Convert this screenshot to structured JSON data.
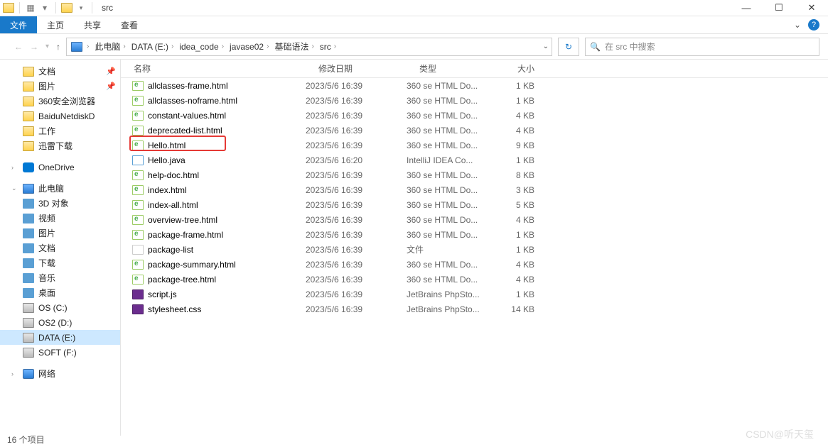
{
  "title": "src",
  "ribbon": {
    "file": "文件",
    "tabs": [
      "主页",
      "共享",
      "查看"
    ]
  },
  "breadcrumb": [
    "此电脑",
    "DATA (E:)",
    "idea_code",
    "javase02",
    "基础语法",
    "src"
  ],
  "search_placeholder": "在 src 中搜索",
  "columns": {
    "name": "名称",
    "date": "修改日期",
    "type": "类型",
    "size": "大小"
  },
  "sidebar": {
    "quick": [
      {
        "label": "文档",
        "icon": "folder",
        "pin": true
      },
      {
        "label": "图片",
        "icon": "folder",
        "pin": true
      },
      {
        "label": "360安全浏览器",
        "icon": "folder"
      },
      {
        "label": "BaiduNetdiskD",
        "icon": "folder"
      },
      {
        "label": "工作",
        "icon": "folder"
      },
      {
        "label": "迅雷下载",
        "icon": "folder"
      }
    ],
    "onedrive": "OneDrive",
    "thispc": "此电脑",
    "pc_items": [
      {
        "label": "3D 对象",
        "icon": "blue"
      },
      {
        "label": "视频",
        "icon": "blue"
      },
      {
        "label": "图片",
        "icon": "blue"
      },
      {
        "label": "文档",
        "icon": "blue"
      },
      {
        "label": "下载",
        "icon": "blue"
      },
      {
        "label": "音乐",
        "icon": "blue"
      },
      {
        "label": "桌面",
        "icon": "blue"
      },
      {
        "label": "OS (C:)",
        "icon": "drive"
      },
      {
        "label": "OS2 (D:)",
        "icon": "drive"
      },
      {
        "label": "DATA (E:)",
        "icon": "drive",
        "selected": true
      },
      {
        "label": "SOFT (F:)",
        "icon": "drive"
      }
    ],
    "network": "网络"
  },
  "files": [
    {
      "name": "allclasses-frame.html",
      "date": "2023/5/6 16:39",
      "type": "360 se HTML Do...",
      "size": "1 KB",
      "icon": "html"
    },
    {
      "name": "allclasses-noframe.html",
      "date": "2023/5/6 16:39",
      "type": "360 se HTML Do...",
      "size": "1 KB",
      "icon": "html"
    },
    {
      "name": "constant-values.html",
      "date": "2023/5/6 16:39",
      "type": "360 se HTML Do...",
      "size": "4 KB",
      "icon": "html"
    },
    {
      "name": "deprecated-list.html",
      "date": "2023/5/6 16:39",
      "type": "360 se HTML Do...",
      "size": "4 KB",
      "icon": "html"
    },
    {
      "name": "Hello.html",
      "date": "2023/5/6 16:39",
      "type": "360 se HTML Do...",
      "size": "9 KB",
      "icon": "html",
      "highlight": true
    },
    {
      "name": "Hello.java",
      "date": "2023/5/6 16:20",
      "type": "IntelliJ IDEA Co...",
      "size": "1 KB",
      "icon": "java"
    },
    {
      "name": "help-doc.html",
      "date": "2023/5/6 16:39",
      "type": "360 se HTML Do...",
      "size": "8 KB",
      "icon": "html"
    },
    {
      "name": "index.html",
      "date": "2023/5/6 16:39",
      "type": "360 se HTML Do...",
      "size": "3 KB",
      "icon": "html"
    },
    {
      "name": "index-all.html",
      "date": "2023/5/6 16:39",
      "type": "360 se HTML Do...",
      "size": "5 KB",
      "icon": "html"
    },
    {
      "name": "overview-tree.html",
      "date": "2023/5/6 16:39",
      "type": "360 se HTML Do...",
      "size": "4 KB",
      "icon": "html"
    },
    {
      "name": "package-frame.html",
      "date": "2023/5/6 16:39",
      "type": "360 se HTML Do...",
      "size": "1 KB",
      "icon": "html"
    },
    {
      "name": "package-list",
      "date": "2023/5/6 16:39",
      "type": "文件",
      "size": "1 KB",
      "icon": "text"
    },
    {
      "name": "package-summary.html",
      "date": "2023/5/6 16:39",
      "type": "360 se HTML Do...",
      "size": "4 KB",
      "icon": "html"
    },
    {
      "name": "package-tree.html",
      "date": "2023/5/6 16:39",
      "type": "360 se HTML Do...",
      "size": "4 KB",
      "icon": "html"
    },
    {
      "name": "script.js",
      "date": "2023/5/6 16:39",
      "type": "JetBrains PhpSto...",
      "size": "1 KB",
      "icon": "ps"
    },
    {
      "name": "stylesheet.css",
      "date": "2023/5/6 16:39",
      "type": "JetBrains PhpSto...",
      "size": "14 KB",
      "icon": "ps"
    }
  ],
  "status": "16 个项目",
  "watermark": "CSDN@听天玺"
}
